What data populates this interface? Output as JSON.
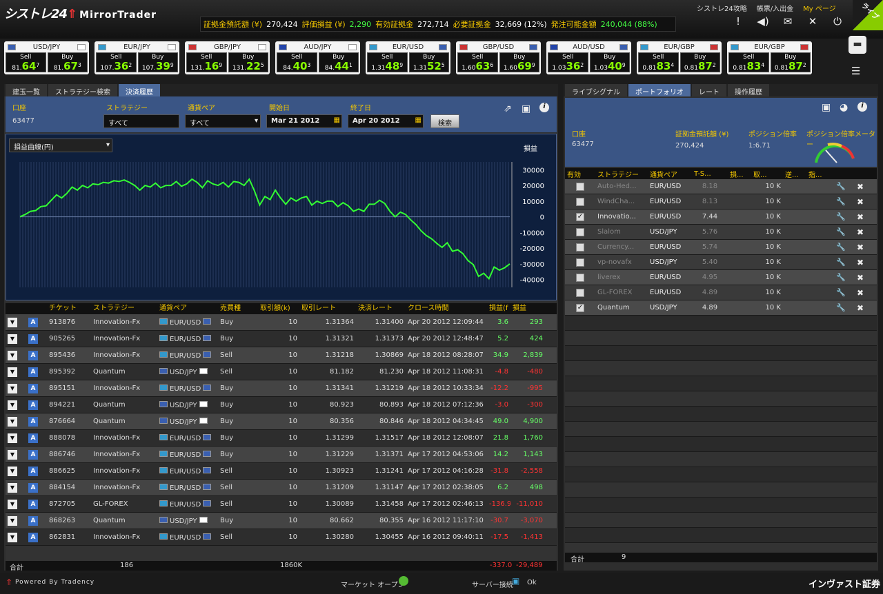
{
  "app": {
    "logo_text": "シストレ24",
    "logo_brand": "MirrorTrader"
  },
  "topstats": [
    {
      "label": "証拠金預託額 (¥)",
      "value": "270,424",
      "green": false
    },
    {
      "label": "評価損益 (¥)",
      "value": "2,290",
      "green": true
    },
    {
      "label": "有効証拠金",
      "value": "272,714",
      "green": false
    },
    {
      "label": "必要証拠金",
      "value": "32,669 (12%)",
      "green": false
    },
    {
      "label": "発注可能金額",
      "value": "240,044 (88%)",
      "green": true
    }
  ],
  "toplinks": {
    "guide": "シストレ24攻略",
    "ledger": "帳票/入出金",
    "mypage": "My ページ",
    "live": "ライブ"
  },
  "quotes": [
    {
      "pair": "USD/JPY",
      "sell_pre": "81.",
      "sell_big": "64",
      "sell_sup": "7",
      "buy_pre": "81.",
      "buy_big": "67",
      "buy_sup": "3",
      "flag1": "#3a5fb0",
      "flag2": "#fff"
    },
    {
      "pair": "EUR/JPY",
      "sell_pre": "107.",
      "sell_big": "36",
      "sell_sup": "2",
      "buy_pre": "107.",
      "buy_big": "39",
      "buy_sup": "9",
      "flag1": "#39c",
      "flag2": "#fff"
    },
    {
      "pair": "GBP/JPY",
      "sell_pre": "131.",
      "sell_big": "16",
      "sell_sup": "9",
      "buy_pre": "131.",
      "buy_big": "22",
      "buy_sup": "5",
      "flag1": "#c33",
      "flag2": "#fff"
    },
    {
      "pair": "AUD/JPY",
      "sell_pre": "84.",
      "sell_big": "40",
      "sell_sup": "3",
      "buy_pre": "84.",
      "buy_big": "44",
      "buy_sup": "1",
      "flag1": "#24a",
      "flag2": "#fff"
    },
    {
      "pair": "EUR/USD",
      "sell_pre": "1.31",
      "sell_big": "48",
      "sell_sup": "9",
      "buy_pre": "1.31",
      "buy_big": "52",
      "buy_sup": "5",
      "flag1": "#39c",
      "flag2": "#3a5fb0"
    },
    {
      "pair": "GBP/USD",
      "sell_pre": "1.60",
      "sell_big": "63",
      "sell_sup": "6",
      "buy_pre": "1.60",
      "buy_big": "69",
      "buy_sup": "9",
      "flag1": "#c33",
      "flag2": "#3a5fb0"
    },
    {
      "pair": "AUD/USD",
      "sell_pre": "1.03",
      "sell_big": "36",
      "sell_sup": "2",
      "buy_pre": "1.03",
      "buy_big": "40",
      "buy_sup": "9",
      "flag1": "#24a",
      "flag2": "#3a5fb0"
    },
    {
      "pair": "EUR/GBP",
      "sell_pre": "0.81",
      "sell_big": "83",
      "sell_sup": "4",
      "buy_pre": "0.81",
      "buy_big": "87",
      "buy_sup": "2",
      "flag1": "#39c",
      "flag2": "#c33"
    },
    {
      "pair": "EUR/GBP",
      "sell_pre": "0.81",
      "sell_big": "83",
      "sell_sup": "4",
      "buy_pre": "0.81",
      "buy_big": "87",
      "buy_sup": "2",
      "flag1": "#39c",
      "flag2": "#c33"
    }
  ],
  "quote_labels": {
    "sell": "Sell",
    "buy": "Buy"
  },
  "left_tabs": [
    "建玉一覧",
    "ストラテジー検索",
    "決済履歴"
  ],
  "filter": {
    "account_label": "口座",
    "account_value": "63477",
    "strategy_label": "ストラテジー",
    "strategy_value": "すべて",
    "pair_label": "通貨ペア",
    "pair_value": "すべて",
    "start_label": "開始日",
    "start_value": "Mar 21 2012",
    "end_label": "終了日",
    "end_value": "Apr 20 2012",
    "search_button": "検索"
  },
  "chart_select": "損益曲線(円)",
  "chart_data": {
    "type": "line",
    "title": "",
    "ylabel": "損益",
    "ylim": [
      -45000,
      35000
    ],
    "yticks": [
      30000,
      20000,
      10000,
      0,
      -10000,
      -20000,
      -30000,
      -40000
    ],
    "values": [
      0,
      1500,
      3500,
      4000,
      6500,
      7000,
      10500,
      14000,
      12000,
      15000,
      19000,
      17000,
      20000,
      18500,
      21000,
      20500,
      22000,
      21500,
      23000,
      22500,
      23500,
      22000,
      20000,
      17000,
      20000,
      19000,
      21500,
      18500,
      20000,
      20000,
      22500,
      19500,
      21000,
      24000,
      22000,
      18500,
      23000,
      21000,
      20000,
      22000,
      19000,
      22500,
      22000,
      20000,
      24000,
      16500,
      7500,
      13000,
      11000,
      17000,
      12000,
      8000,
      12000,
      10000,
      12000,
      13000,
      7500,
      10000,
      8500,
      10000,
      10000,
      6500,
      9000,
      7000,
      3500,
      5000,
      3500,
      8000,
      8000,
      10500,
      8500,
      3500,
      0,
      3000,
      1500,
      -2000,
      -5000,
      -9000,
      -12000,
      -14000,
      -17000,
      -19500,
      -16500,
      -22000,
      -21000,
      -23500,
      -28000,
      -30500,
      -38000,
      -36000,
      -39500,
      -32000,
      -34000,
      -32500,
      -30000
    ]
  },
  "trade_headers": [
    "チケット",
    "ストラテジー",
    "通貨ペア",
    "売買種",
    "取引額(k)",
    "取引レート",
    "決済レート",
    "クロース時間",
    "損益(f",
    "損益"
  ],
  "trades": [
    {
      "ticket": "913876",
      "strategy": "Innovation-Fx",
      "pair": "EUR/USD",
      "f1": "#39c",
      "f2": "#3a5fb0",
      "side": "Buy",
      "amount": "10",
      "rate": "1.31364",
      "close_rate": "1.31400",
      "time": "Apr 20 2012 12:09:44",
      "pips": "3.6",
      "pnl": "293",
      "neg": false
    },
    {
      "ticket": "905265",
      "strategy": "Innovation-Fx",
      "pair": "EUR/USD",
      "f1": "#39c",
      "f2": "#3a5fb0",
      "side": "Buy",
      "amount": "10",
      "rate": "1.31321",
      "close_rate": "1.31373",
      "time": "Apr 20 2012 12:48:47",
      "pips": "5.2",
      "pnl": "424",
      "neg": false
    },
    {
      "ticket": "895436",
      "strategy": "Innovation-Fx",
      "pair": "EUR/USD",
      "f1": "#39c",
      "f2": "#3a5fb0",
      "side": "Sell",
      "amount": "10",
      "rate": "1.31218",
      "close_rate": "1.30869",
      "time": "Apr 18 2012 08:28:07",
      "pips": "34.9",
      "pnl": "2,839",
      "neg": false
    },
    {
      "ticket": "895392",
      "strategy": "Quantum",
      "pair": "USD/JPY",
      "f1": "#3a5fb0",
      "f2": "#fff",
      "side": "Sell",
      "amount": "10",
      "rate": "81.182",
      "close_rate": "81.230",
      "time": "Apr 18 2012 11:08:31",
      "pips": "-4.8",
      "pnl": "-480",
      "neg": true
    },
    {
      "ticket": "895151",
      "strategy": "Innovation-Fx",
      "pair": "EUR/USD",
      "f1": "#39c",
      "f2": "#3a5fb0",
      "side": "Buy",
      "amount": "10",
      "rate": "1.31341",
      "close_rate": "1.31219",
      "time": "Apr 18 2012 10:33:34",
      "pips": "-12.2",
      "pnl": "-995",
      "neg": true
    },
    {
      "ticket": "894221",
      "strategy": "Quantum",
      "pair": "USD/JPY",
      "f1": "#3a5fb0",
      "f2": "#fff",
      "side": "Buy",
      "amount": "10",
      "rate": "80.923",
      "close_rate": "80.893",
      "time": "Apr 18 2012 07:12:36",
      "pips": "-3.0",
      "pnl": "-300",
      "neg": true
    },
    {
      "ticket": "876664",
      "strategy": "Quantum",
      "pair": "USD/JPY",
      "f1": "#3a5fb0",
      "f2": "#fff",
      "side": "Buy",
      "amount": "10",
      "rate": "80.356",
      "close_rate": "80.846",
      "time": "Apr 18 2012 04:34:45",
      "pips": "49.0",
      "pnl": "4,900",
      "neg": false
    },
    {
      "ticket": "888078",
      "strategy": "Innovation-Fx",
      "pair": "EUR/USD",
      "f1": "#39c",
      "f2": "#3a5fb0",
      "side": "Buy",
      "amount": "10",
      "rate": "1.31299",
      "close_rate": "1.31517",
      "time": "Apr 18 2012 12:08:07",
      "pips": "21.8",
      "pnl": "1,760",
      "neg": false
    },
    {
      "ticket": "886746",
      "strategy": "Innovation-Fx",
      "pair": "EUR/USD",
      "f1": "#39c",
      "f2": "#3a5fb0",
      "side": "Buy",
      "amount": "10",
      "rate": "1.31229",
      "close_rate": "1.31371",
      "time": "Apr 17 2012 04:53:06",
      "pips": "14.2",
      "pnl": "1,143",
      "neg": false
    },
    {
      "ticket": "886625",
      "strategy": "Innovation-Fx",
      "pair": "EUR/USD",
      "f1": "#39c",
      "f2": "#3a5fb0",
      "side": "Sell",
      "amount": "10",
      "rate": "1.30923",
      "close_rate": "1.31241",
      "time": "Apr 17 2012 04:16:28",
      "pips": "-31.8",
      "pnl": "-2,558",
      "neg": true
    },
    {
      "ticket": "884154",
      "strategy": "Innovation-Fx",
      "pair": "EUR/USD",
      "f1": "#39c",
      "f2": "#3a5fb0",
      "side": "Sell",
      "amount": "10",
      "rate": "1.31209",
      "close_rate": "1.31147",
      "time": "Apr 17 2012 02:38:05",
      "pips": "6.2",
      "pnl": "498",
      "neg": false
    },
    {
      "ticket": "872705",
      "strategy": "GL-FOREX",
      "pair": "EUR/USD",
      "f1": "#39c",
      "f2": "#3a5fb0",
      "side": "Sell",
      "amount": "10",
      "rate": "1.30089",
      "close_rate": "1.31458",
      "time": "Apr 17 2012 02:46:13",
      "pips": "-136.9",
      "pnl": "-11,010",
      "neg": true
    },
    {
      "ticket": "868263",
      "strategy": "Quantum",
      "pair": "USD/JPY",
      "f1": "#3a5fb0",
      "f2": "#fff",
      "side": "Buy",
      "amount": "10",
      "rate": "80.662",
      "close_rate": "80.355",
      "time": "Apr 16 2012 11:17:10",
      "pips": "-30.7",
      "pnl": "-3,070",
      "neg": true
    },
    {
      "ticket": "862831",
      "strategy": "Innovation-Fx",
      "pair": "EUR/USD",
      "f1": "#39c",
      "f2": "#3a5fb0",
      "side": "Sell",
      "amount": "10",
      "rate": "1.30280",
      "close_rate": "1.30455",
      "time": "Apr 16 2012 09:40:11",
      "pips": "-17.5",
      "pnl": "-1,413",
      "neg": true
    }
  ],
  "trade_footer": {
    "label": "合計",
    "count": "186",
    "amount": "1860K",
    "pips": "-337.0",
    "pnl": "-29,489"
  },
  "right_tabs": [
    "ライブシグナル",
    "ポートフォリオ",
    "レート",
    "操作履歴"
  ],
  "account_box": {
    "account_label": "口座",
    "account_value": "63477",
    "margin_label": "証拠金預託額 (¥)",
    "margin_value": "270,424",
    "leverage_label": "ポジション倍率",
    "leverage_value": "1:6.71",
    "meter_label": "ポジション倍率メーター"
  },
  "portfolio_headers": [
    "有効",
    "ストラテジー",
    "通貨ペア",
    "T-S...",
    "損...",
    "取...",
    "逆...",
    "指..."
  ],
  "portfolio": [
    {
      "active": false,
      "name": "Auto-Hed...",
      "pair": "EUR/USD",
      "ts": "8.18",
      "amount": "10 K"
    },
    {
      "active": false,
      "name": "WindCha...",
      "pair": "EUR/USD",
      "ts": "8.13",
      "amount": "10 K"
    },
    {
      "active": true,
      "name": "Innovatio...",
      "pair": "EUR/USD",
      "ts": "7.44",
      "amount": "10 K"
    },
    {
      "active": false,
      "name": "Slalom",
      "pair": "USD/JPY",
      "ts": "5.76",
      "amount": "10 K"
    },
    {
      "active": false,
      "name": "Currency...",
      "pair": "EUR/USD",
      "ts": "5.74",
      "amount": "10 K"
    },
    {
      "active": false,
      "name": "vp-novafx",
      "pair": "USD/JPY",
      "ts": "5.40",
      "amount": "10 K"
    },
    {
      "active": false,
      "name": "liverex",
      "pair": "EUR/USD",
      "ts": "4.95",
      "amount": "10 K"
    },
    {
      "active": false,
      "name": "GL-FOREX",
      "pair": "EUR/USD",
      "ts": "4.89",
      "amount": "10 K"
    },
    {
      "active": true,
      "name": "Quantum",
      "pair": "USD/JPY",
      "ts": "4.89",
      "amount": "10 K"
    }
  ],
  "portfolio_footer": {
    "label": "合計",
    "count": "9"
  },
  "statusbar": {
    "powered": "Powered By Tradency",
    "market": "マーケット オープン",
    "server": "サーバー接続",
    "server_status": "Ok",
    "broker": "インヴァスト証券"
  }
}
